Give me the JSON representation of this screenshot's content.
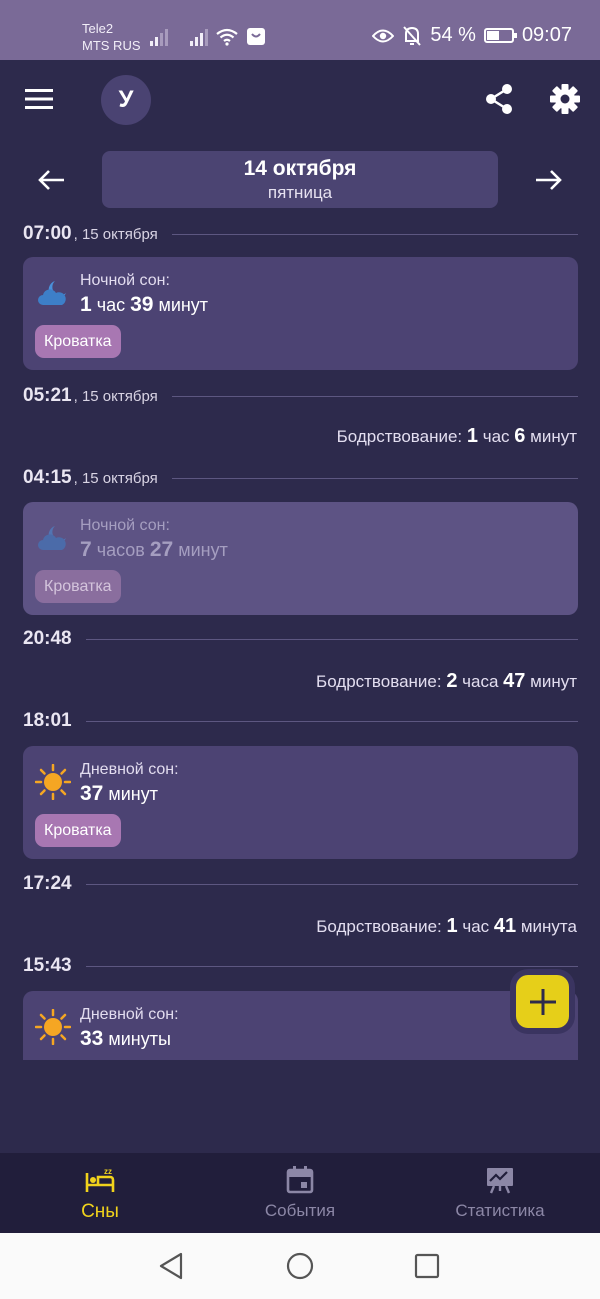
{
  "status": {
    "carrier1": "Tele2",
    "carrier2": "MTS RUS",
    "battery": "54 %",
    "battery_level": 0.54,
    "time": "09:07"
  },
  "header": {
    "avatar_letter": "У",
    "date_title": "14 октября",
    "date_weekday": "пятница"
  },
  "timeline": [
    {
      "time": "07:00",
      "date": ", 15 октября"
    },
    {
      "type": "sleep",
      "label": "Ночной сон:",
      "n1": "1",
      "u1": " час ",
      "n2": "39",
      "u2": " минут",
      "tag": "Кроватка",
      "icon": "cloud-moon-icon"
    },
    {
      "time": "05:21",
      "date": ", 15 октября"
    },
    {
      "type": "wake",
      "label": "Бодрствование: ",
      "n1": "1",
      "u1": " час ",
      "n2": "6",
      "u2": " минут"
    },
    {
      "time": "04:15",
      "date": ", 15 октября"
    },
    {
      "type": "sleep",
      "label": "Ночной сон:",
      "n1": "7",
      "u1": " часов ",
      "n2": "27",
      "u2": " минут",
      "tag": "Кроватка",
      "icon": "cloud-moon-icon"
    },
    {
      "time": "20:48"
    },
    {
      "type": "wake",
      "label": "Бодрствование: ",
      "n1": "2",
      "u1": " часа ",
      "n2": "47",
      "u2": " минут"
    },
    {
      "time": "18:01"
    },
    {
      "type": "sleep",
      "label": "Дневной сон:",
      "n1": "37",
      "u1": " минут",
      "tag": "Кроватка",
      "icon": "sun-icon"
    },
    {
      "time": "17:24"
    },
    {
      "type": "wake",
      "label": "Бодрствование: ",
      "n1": "1",
      "u1": " час ",
      "n2": "41",
      "u2": " минута"
    },
    {
      "time": "15:43"
    },
    {
      "type": "sleep",
      "label": "Дневной сон:",
      "n1": "33",
      "u1": " минуты",
      "icon": "sun-icon"
    }
  ],
  "nav": {
    "sleeps": "Сны",
    "events": "События",
    "stats": "Статистика"
  },
  "colors": {
    "background": "#2d2a4c",
    "card": "#4c4373",
    "tag": "#a877b2",
    "accent": "#f0d21c",
    "status_bar": "#7a6a97"
  }
}
